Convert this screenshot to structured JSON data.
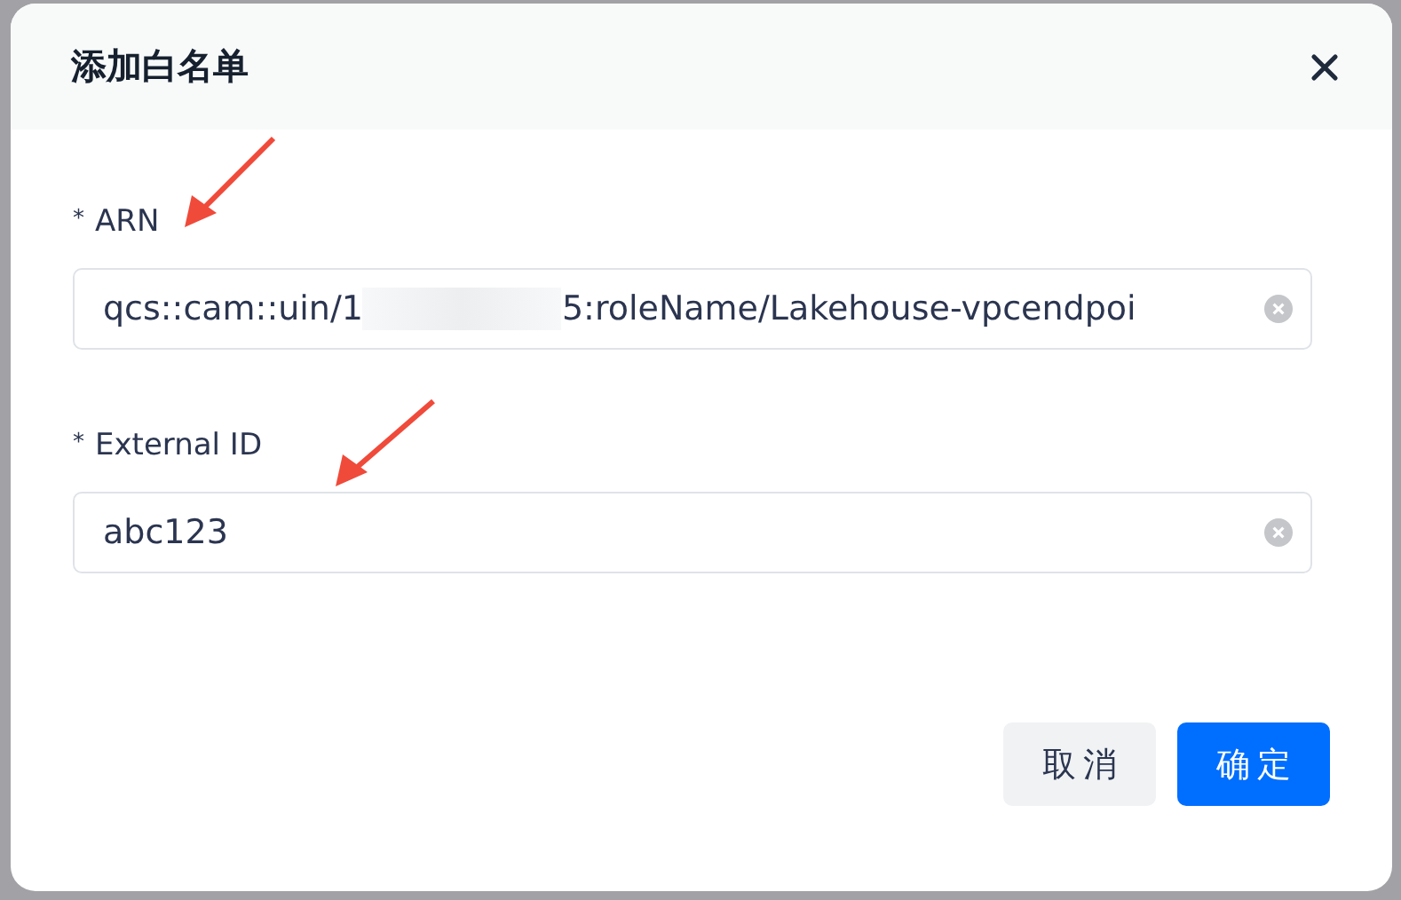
{
  "dialog": {
    "title": "添加白名单",
    "fields": [
      {
        "label": "ARN",
        "required_mark": "*",
        "value": "qcs::cam::uin/1",
        "redacted": true,
        "value_rest": "5:roleName/Lakehouse-vpcendpoi"
      },
      {
        "label": "External ID",
        "required_mark": "*",
        "value": "abc123"
      }
    ],
    "buttons": [
      {
        "label": "取消",
        "kind": "secondary"
      },
      {
        "label": "确定",
        "kind": "primary"
      }
    ]
  }
}
